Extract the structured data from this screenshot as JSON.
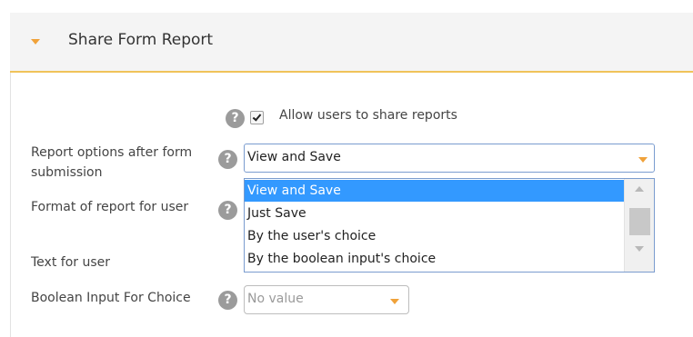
{
  "section": {
    "title": "Share Form Report",
    "caret_icon": "caret-down-icon"
  },
  "allow_share": {
    "checked": true,
    "label": "Allow users to share reports"
  },
  "fields": {
    "report_options_label": "Report options after form submission",
    "format_label": "Format of report for user",
    "text_label": "Text for user",
    "boolean_label": "Boolean Input For Choice",
    "help_glyph": "?"
  },
  "report_options_select": {
    "value": "View and Save",
    "options": [
      "View and Save",
      "Just Save",
      "By the user's choice",
      "By the boolean input's choice"
    ],
    "selected_index": 0
  },
  "boolean_select": {
    "value": "No value"
  },
  "colors": {
    "accent": "#f0a23a",
    "header_border": "#f0c35a",
    "selection": "#3399ff",
    "help_icon": "#9b9b9b"
  }
}
